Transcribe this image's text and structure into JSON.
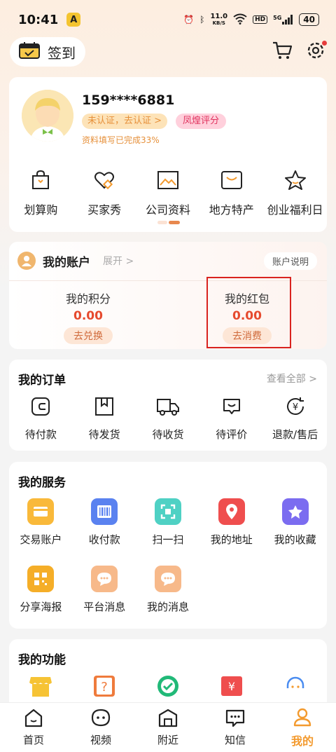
{
  "status_bar": {
    "time": "10:41",
    "net_speed_value": "11.0",
    "net_speed_unit": "KB/S",
    "battery": "40",
    "hd": "HD",
    "signal": "5G"
  },
  "topbar": {
    "checkin_label": "签到"
  },
  "profile": {
    "phone": "159****6881",
    "verify_badge": "未认证，去认证 >",
    "rating_badge": "凤煌评分",
    "progress_text": "资料填写已完成33%"
  },
  "quick_links": [
    {
      "label": "划算购",
      "icon": "shopping-bag-icon"
    },
    {
      "label": "买家秀",
      "icon": "heart-tag-icon"
    },
    {
      "label": "公司资料",
      "icon": "picture-icon"
    },
    {
      "label": "地方特产",
      "icon": "mailbox-icon"
    },
    {
      "label": "创业福利日",
      "icon": "star-icon"
    }
  ],
  "account": {
    "title": "我的账户",
    "expand": "展开 >",
    "help": "账户说明",
    "points_label": "我的积分",
    "points_value": "0.00",
    "points_action": "去兑换",
    "redpack_label": "我的红包",
    "redpack_value": "0.00",
    "redpack_action": "去消费"
  },
  "orders": {
    "title": "我的订单",
    "see_all": "查看全部 >",
    "items": [
      {
        "label": "待付款",
        "icon": "wallet-icon"
      },
      {
        "label": "待发货",
        "icon": "package-icon"
      },
      {
        "label": "待收货",
        "icon": "truck-icon"
      },
      {
        "label": "待评价",
        "icon": "comment-icon"
      },
      {
        "label": "退款/售后",
        "icon": "refund-icon"
      }
    ]
  },
  "services": {
    "title": "我的服务",
    "items": [
      {
        "label": "交易账户",
        "icon": "card-icon",
        "color": "#f9b93a"
      },
      {
        "label": "收付款",
        "icon": "barcode-icon",
        "color": "#5a82f0"
      },
      {
        "label": "扫一扫",
        "icon": "scan-icon",
        "color": "#4fd1c4"
      },
      {
        "label": "我的地址",
        "icon": "location-pin-icon",
        "color": "#ef4e4e"
      },
      {
        "label": "我的收藏",
        "icon": "star-icon",
        "color": "#7b6cf0"
      },
      {
        "label": "分享海报",
        "icon": "qr-code-icon",
        "color": "#f5ae28"
      },
      {
        "label": "平台消息",
        "icon": "chat-bubble-icon",
        "color": "#f7b98a"
      },
      {
        "label": "我的消息",
        "icon": "chat-bubble-icon",
        "color": "#f7b98a"
      }
    ]
  },
  "functions": {
    "title": "我的功能"
  },
  "bottom_nav": [
    {
      "label": "首页",
      "icon": "home-icon"
    },
    {
      "label": "视频",
      "icon": "video-icon"
    },
    {
      "label": "附近",
      "icon": "nearby-shop-icon"
    },
    {
      "label": "知信",
      "icon": "message-icon"
    },
    {
      "label": "我的",
      "icon": "profile-icon"
    }
  ],
  "colors": {
    "accent": "#f39a2e",
    "price": "#e64a2e",
    "highlight": "#d9231f"
  }
}
